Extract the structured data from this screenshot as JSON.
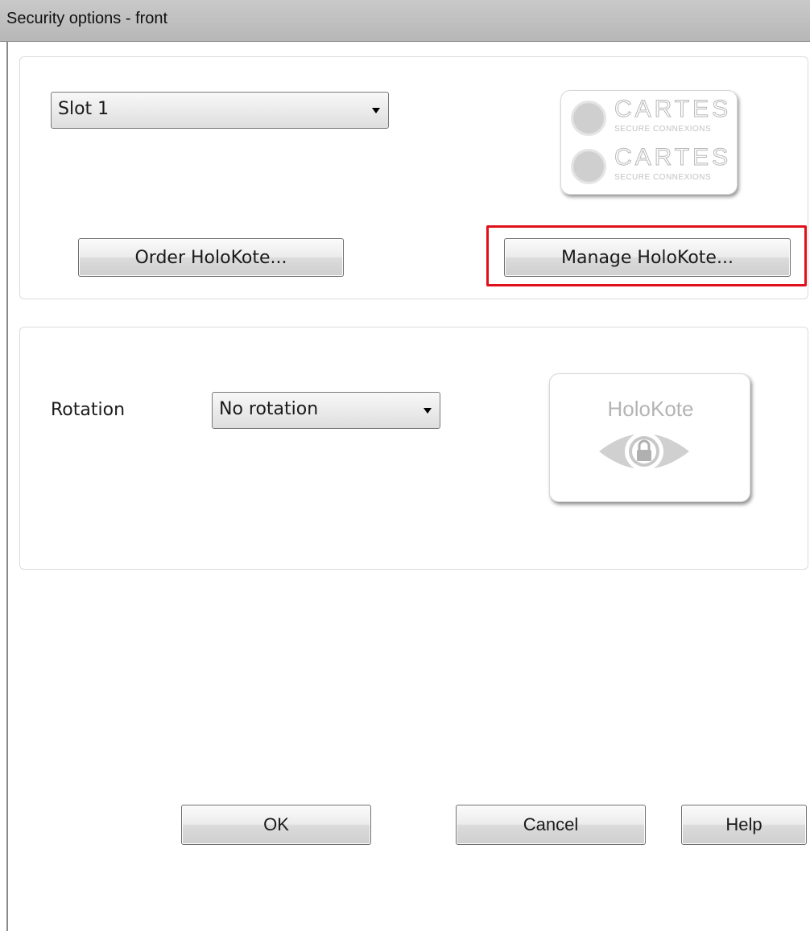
{
  "window": {
    "title": "Security options - front"
  },
  "slot_select": {
    "value": "Slot 1"
  },
  "order_button": {
    "label": "Order HoloKote..."
  },
  "manage_button": {
    "label": "Manage HoloKote..."
  },
  "brand_logo": {
    "name": "CARTES",
    "tagline": "SECURE CONNEXIONS"
  },
  "rotation": {
    "label": "Rotation",
    "value": "No rotation"
  },
  "holokote_preview": {
    "text": "HoloKote"
  },
  "footer": {
    "ok": "OK",
    "cancel": "Cancel",
    "help": "Help"
  },
  "colors": {
    "highlight": "#e0101a"
  }
}
